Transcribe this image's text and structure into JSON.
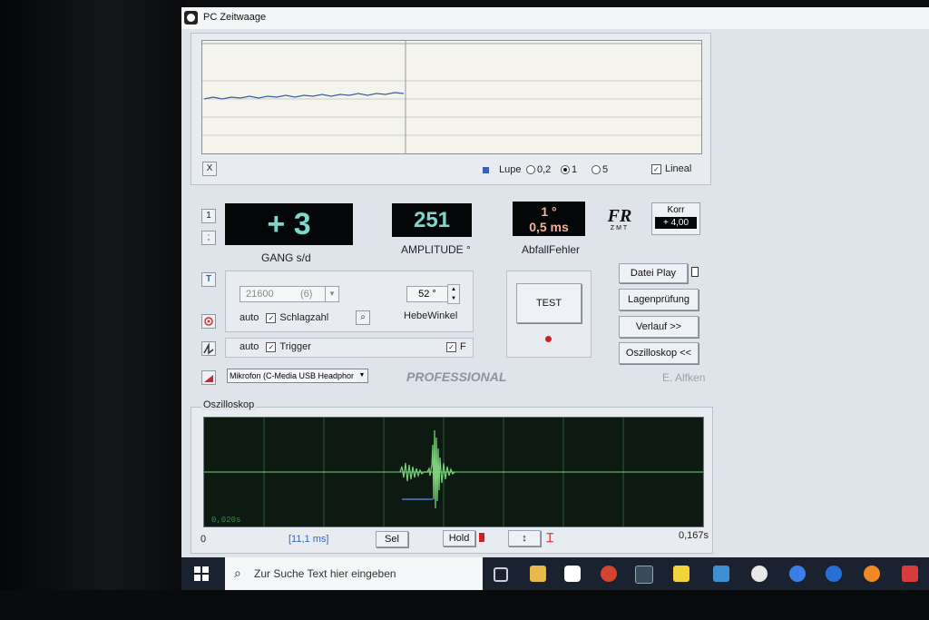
{
  "window": {
    "title": "PC Zeitwaage"
  },
  "top_chart": {
    "x_button": "X",
    "lupe_label": "Lupe",
    "zoom_options": [
      "0,2",
      "1",
      "5"
    ],
    "zoom_selected": "1",
    "lineal_label": "Lineal",
    "lineal_checked": true
  },
  "side_buttons": {
    "btn1": "1",
    "btn2": ";",
    "t_icon": "T"
  },
  "readouts": {
    "gang_value": "+ 3",
    "gang_label": "GANG s/d",
    "amplitude_value": "251",
    "amplitude_label": "AMPLITUDE °",
    "abfall_value1": "1 °",
    "abfall_value2": "0,5 ms",
    "abfall_label": "AbfallFehler",
    "logo_text": "FR",
    "logo_sub": "ZMT",
    "korr_label": "Korr",
    "korr_value": "+ 4,00"
  },
  "settings": {
    "schlagzahl_value": "21600",
    "schlagzahl_sub": "(6)",
    "auto_label": "auto",
    "schlagzahl_label": "Schlagzahl",
    "hebewinkel_value": "52 °",
    "hebewinkel_label": "HebeWinkel",
    "trigger_label": "Trigger",
    "f_label": "F",
    "mic_value": "Mikrofon (C-Media USB Headphor"
  },
  "test": {
    "label": "TEST"
  },
  "right_buttons": {
    "datei_play": "Datei Play",
    "lagenpruefung": "Lagenprüfung",
    "verlauf": "Verlauf >>",
    "oszilloskop_btn": "Oszilloskop <<"
  },
  "branding": {
    "professional": "PROFESSIONAL",
    "author": "E. Alfken"
  },
  "oscilloscope": {
    "title": "Oszilloskop",
    "scale_text": "0,020s",
    "start_label": "0",
    "window_label": "[11,1 ms]",
    "sel_label": "Sel",
    "hold_label": "Hold",
    "arrows_label": "↕",
    "end_label": "0,167s"
  },
  "taskbar": {
    "search_placeholder": "Zur Suche Text hier eingeben"
  },
  "colors": {
    "display_text": "#7dd7cb",
    "abfall_text": "#f2b39a",
    "scope_trace": "#7cd07a",
    "scope_bg": "#0c1a12"
  }
}
